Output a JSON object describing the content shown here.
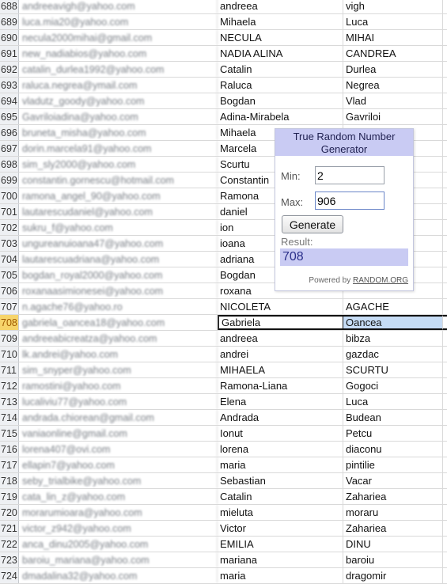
{
  "sheet": {
    "rows": [
      {
        "num": "688",
        "email": "andreeavigh@yahoo.com",
        "first": "andreea",
        "last": "vigh"
      },
      {
        "num": "689",
        "email": "luca.mia20@yahoo.com",
        "first": "Mihaela",
        "last": "Luca"
      },
      {
        "num": "690",
        "email": "necula2000mihai@gmail.com",
        "first": "NECULA",
        "last": "MIHAI"
      },
      {
        "num": "691",
        "email": "new_nadiabios@yahoo.com",
        "first": "NADIA ALINA",
        "last": "CANDREA"
      },
      {
        "num": "692",
        "email": "catalin_durlea1992@yahoo.com",
        "first": "Catalin",
        "last": "Durlea"
      },
      {
        "num": "693",
        "email": "raluca.negrea@ymail.com",
        "first": "Raluca",
        "last": "Negrea"
      },
      {
        "num": "694",
        "email": "vladutz_goody@yahoo.com",
        "first": "Bogdan",
        "last": "Vlad"
      },
      {
        "num": "695",
        "email": "Gavriloiadina@yahoo.com",
        "first": "Adina-Mirabela",
        "last": "Gavriloi"
      },
      {
        "num": "696",
        "email": "bruneta_misha@yahoo.com",
        "first": "Mihaela",
        "last": ""
      },
      {
        "num": "697",
        "email": "dorin.marcela91@yahoo.com",
        "first": "Marcela",
        "last": ""
      },
      {
        "num": "698",
        "email": "sim_sly2000@yahoo.com",
        "first": "Scurtu",
        "last": ""
      },
      {
        "num": "699",
        "email": "constantin.gornescu@hotmail.com",
        "first": "Constantin",
        "last": ""
      },
      {
        "num": "700",
        "email": "ramona_angel_90@yahoo.com",
        "first": "Ramona",
        "last": ""
      },
      {
        "num": "701",
        "email": "lautarescudaniel@yahoo.com",
        "first": "daniel",
        "last": ""
      },
      {
        "num": "702",
        "email": "sukru_f@yahoo.com",
        "first": "ion",
        "last": ""
      },
      {
        "num": "703",
        "email": "ungureanuioana47@yahoo.com",
        "first": "ioana",
        "last": ""
      },
      {
        "num": "704",
        "email": "lautarescuadriana@yahoo.com",
        "first": "adriana",
        "last": ""
      },
      {
        "num": "705",
        "email": "bogdan_royal2000@yahoo.com",
        "first": "Bogdan",
        "last": ""
      },
      {
        "num": "706",
        "email": "roxanaasimionesei@yahoo.com",
        "first": "roxana",
        "last": ""
      },
      {
        "num": "707",
        "email": "n.agache76@yahoo.ro",
        "first": "NICOLETA",
        "last": "AGACHE"
      },
      {
        "num": "708",
        "email": "gabriela_oancea18@yahoo.com",
        "first": "Gabriela",
        "last": "Oancea",
        "selected": true
      },
      {
        "num": "709",
        "email": "andreeabicreatza@yahoo.com",
        "first": "andreea",
        "last": "bibza"
      },
      {
        "num": "710",
        "email": "lk.andrei@yahoo.com",
        "first": "andrei",
        "last": "gazdac"
      },
      {
        "num": "711",
        "email": "sim_snyper@yahoo.com",
        "first": "MIHAELA",
        "last": "SCURTU"
      },
      {
        "num": "712",
        "email": "ramostini@yahoo.com",
        "first": "Ramona-Liana",
        "last": "Gogoci"
      },
      {
        "num": "713",
        "email": "lucaliviu77@yahoo.com",
        "first": "Elena",
        "last": "Luca"
      },
      {
        "num": "714",
        "email": "andrada.chiorean@gmail.com",
        "first": "Andrada",
        "last": "Budean"
      },
      {
        "num": "715",
        "email": "vaniaonline@gmail.com",
        "first": "Ionut",
        "last": "Petcu"
      },
      {
        "num": "716",
        "email": "lorena407@ovi.com",
        "first": "lorena",
        "last": "diaconu"
      },
      {
        "num": "717",
        "email": "ellapin7@yahoo.com",
        "first": "maria",
        "last": "pintilie"
      },
      {
        "num": "718",
        "email": "seby_trialbike@yahoo.com",
        "first": "Sebastian",
        "last": "Vacar"
      },
      {
        "num": "719",
        "email": "cata_lin_z@yahoo.com",
        "first": "Catalin",
        "last": "Zahariea"
      },
      {
        "num": "720",
        "email": "morarumioara@yahoo.com",
        "first": "mieluta",
        "last": "moraru"
      },
      {
        "num": "721",
        "email": "victor_z942@yahoo.com",
        "first": "Victor",
        "last": "Zahariea"
      },
      {
        "num": "722",
        "email": "anca_dinu2005@yahoo.com",
        "first": "EMILIA",
        "last": "DINU"
      },
      {
        "num": "723",
        "email": "baroiu_mariana@yahoo.com",
        "first": "mariana",
        "last": "baroiu"
      },
      {
        "num": "724",
        "email": "dmadalina32@yahoo.com",
        "first": "maria",
        "last": "dragomir"
      }
    ]
  },
  "widget": {
    "title": "True Random Number Generator",
    "min_label": "Min:",
    "min_value": "2",
    "max_label": "Max:",
    "max_value": "906",
    "generate_label": "Generate",
    "result_label": "Result:",
    "result_value": "708",
    "powered_prefix": "Powered by",
    "powered_link": "RANDOM.ORG"
  }
}
